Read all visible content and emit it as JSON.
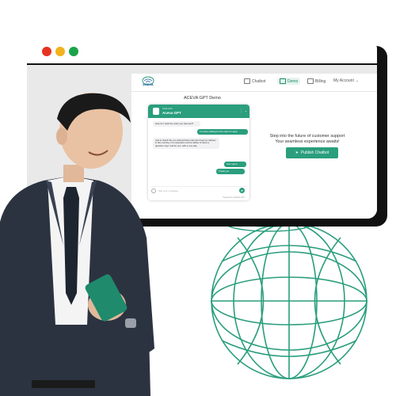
{
  "browser": {
    "controls": [
      "close",
      "minimize",
      "maximize"
    ]
  },
  "app": {
    "logo": "ACEVA",
    "nav": {
      "chatbot": "Chatbot",
      "demo": "Demo",
      "billing": "Billing",
      "account": "My Account"
    },
    "demo_title": "ACEVA GPT Demo",
    "chat": {
      "header_sub": "Chat with",
      "bot_name": "Aceva GPT",
      "messages": [
        {
          "from": "bot",
          "text": "How do I track the order you had sent?"
        },
        {
          "from": "user",
          "text": "I've been waiting for the order for ages"
        },
        {
          "from": "bot",
          "text": "Just to check the you ordered there was item been by delivery in the morning. It is expected must be deliver is there a question may i sell for you, with a very day."
        },
        {
          "from": "user",
          "text": "Can I get it"
        },
        {
          "from": "user",
          "text": "Thank you"
        }
      ],
      "input_placeholder": "Ask your message...",
      "powered_by": "Powered by ACEVA GPT"
    },
    "tagline_line1": "Step into the future of customer support",
    "tagline_line2": "Your seamless experience awaits!",
    "publish_button": "Publish Chatbot"
  },
  "colors": {
    "accent": "#2a9e7d",
    "red": "#e53322",
    "yellow": "#f1b21c",
    "green": "#1aa34a"
  }
}
